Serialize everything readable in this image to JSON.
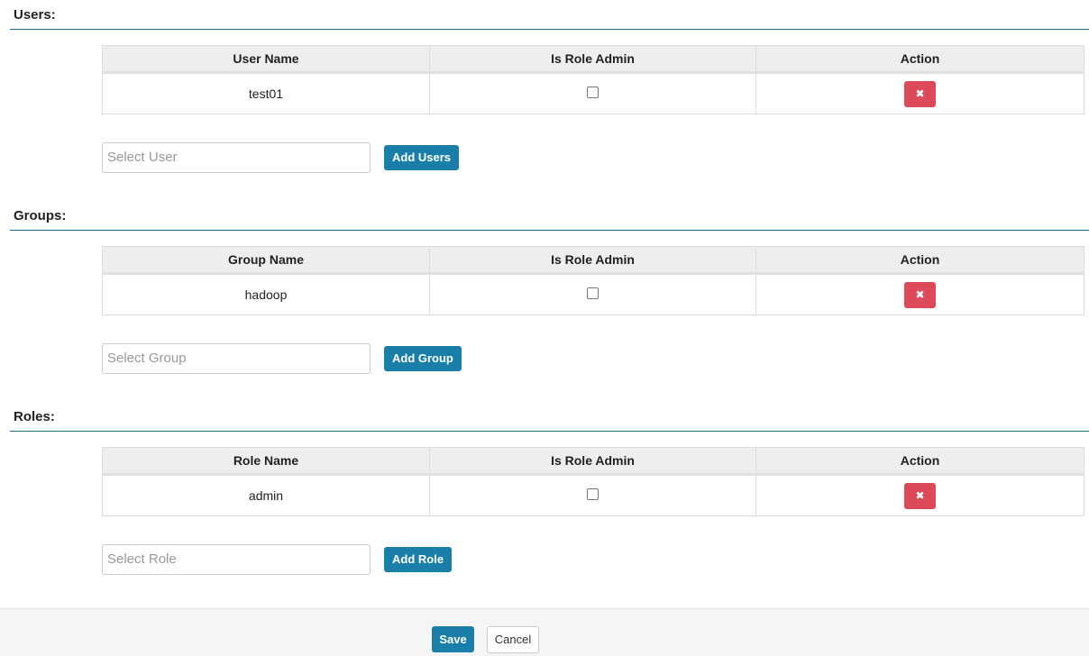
{
  "users": {
    "title": "Users:",
    "columns": [
      "User Name",
      "Is Role Admin",
      "Action"
    ],
    "rows": [
      {
        "name": "test01",
        "is_role_admin": false,
        "action_icon": "times-icon"
      }
    ],
    "select_placeholder": "Select User",
    "add_label": "Add Users"
  },
  "groups": {
    "title": "Groups:",
    "columns": [
      "Group Name",
      "Is Role Admin",
      "Action"
    ],
    "rows": [
      {
        "name": "hadoop",
        "is_role_admin": false,
        "action_icon": "times-icon"
      }
    ],
    "select_placeholder": "Select Group",
    "add_label": "Add Group"
  },
  "roles": {
    "title": "Roles:",
    "columns": [
      "Role Name",
      "Is Role Admin",
      "Action"
    ],
    "rows": [
      {
        "name": "admin",
        "is_role_admin": false,
        "action_icon": "times-icon"
      }
    ],
    "select_placeholder": "Select Role",
    "add_label": "Add Role"
  },
  "footer": {
    "save_label": "Save",
    "cancel_label": "Cancel"
  },
  "colors": {
    "primary": "#1a7fa8",
    "danger": "#dc4a5a",
    "rule": "#1a6e8a"
  }
}
